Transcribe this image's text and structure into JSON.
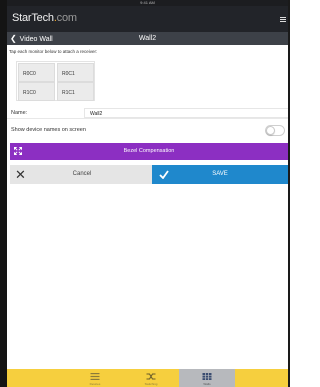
{
  "status_bar": {
    "time": "9:41 AM"
  },
  "brand": {
    "logo_main": "StarTech",
    "logo_dot": ".",
    "logo_suffix": "com"
  },
  "nav": {
    "back_label": "Video Wall",
    "back_chevron": "❮",
    "title": "Wall2"
  },
  "instruction": "Tap each monitor below to attach a receiver:",
  "monitors": [
    {
      "label": "R0C0"
    },
    {
      "label": "R0C1"
    },
    {
      "label": "R1C0"
    },
    {
      "label": "R1C1"
    }
  ],
  "name_field": {
    "label": "Name:",
    "value": "Wall2"
  },
  "device_names_toggle": {
    "label": "Show device names on screen",
    "on": false
  },
  "bezel": {
    "label": "Bezel Compensation",
    "color": "#8c2fc2",
    "icon": "expand-arrows-icon"
  },
  "cancel": {
    "label": "Cancel",
    "icon": "close-icon",
    "glyph": "✕"
  },
  "save": {
    "label": "SAVE",
    "color": "#1f88cc",
    "icon": "check-icon"
  },
  "tabs": [
    {
      "name": "list",
      "label": "Devices",
      "icon": "list-icon",
      "active": false
    },
    {
      "name": "switch",
      "label": "Switching",
      "icon": "shuffle-icon",
      "active": false
    },
    {
      "name": "wall",
      "label": "Walls",
      "icon": "grid-icon",
      "active": true
    }
  ],
  "colors": {
    "tab_bar": "#f6cf3e",
    "nav_bar": "#3d4148",
    "brand_bar": "#222429"
  }
}
